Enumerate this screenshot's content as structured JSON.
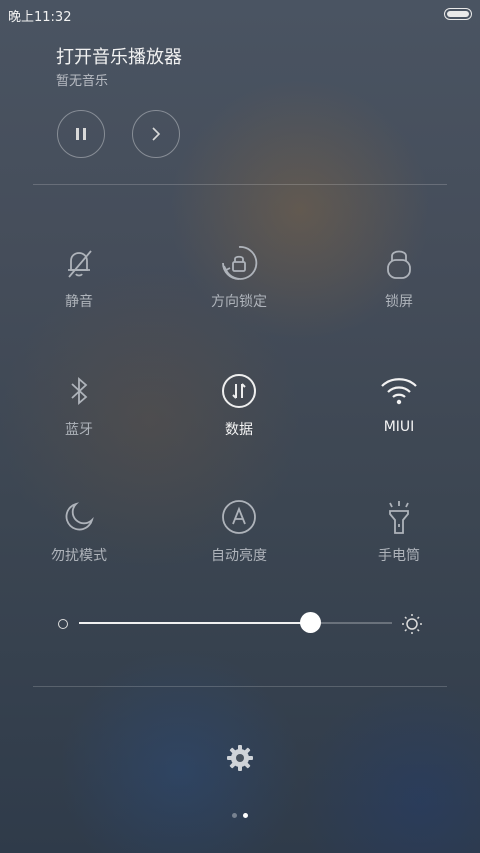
{
  "status_bar": {
    "time": "晚上11:32"
  },
  "music": {
    "title": "打开音乐播放器",
    "subtitle": "暂无音乐"
  },
  "tiles": [
    {
      "label": "静音",
      "icon": "bell-off-icon"
    },
    {
      "label": "方向锁定",
      "icon": "rotation-lock-icon"
    },
    {
      "label": "锁屏",
      "icon": "lock-icon"
    },
    {
      "label": "蓝牙",
      "icon": "bluetooth-icon"
    },
    {
      "label": "数据",
      "icon": "mobile-data-icon"
    },
    {
      "label": "MIUI",
      "icon": "wifi-icon"
    },
    {
      "label": "勿扰模式",
      "icon": "moon-icon"
    },
    {
      "label": "自动亮度",
      "icon": "auto-brightness-icon"
    },
    {
      "label": "手电筒",
      "icon": "flashlight-icon"
    }
  ],
  "brightness": {
    "level": 0.74
  },
  "page_indicator": {
    "current": 2,
    "total": 2
  },
  "colors": {
    "inactive": "#aeb3ba",
    "active": "#f5f5f5"
  }
}
